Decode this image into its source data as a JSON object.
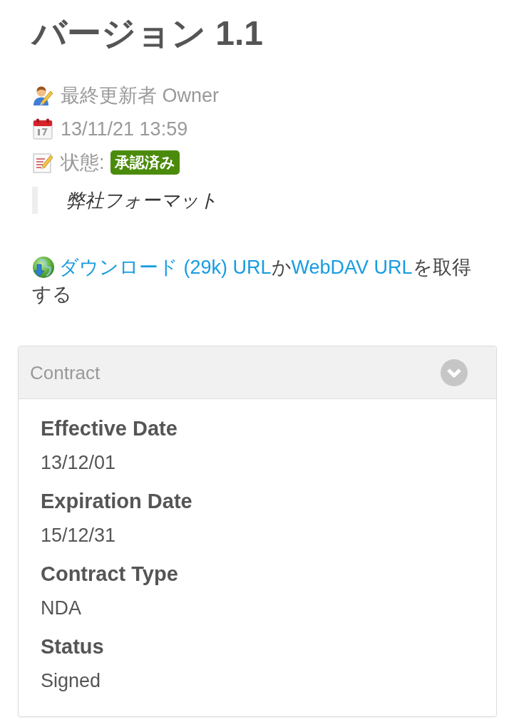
{
  "title": "バージョン 1.1",
  "meta": [
    {
      "kind": "updated_by",
      "text": "最終更新者 Owner"
    },
    {
      "kind": "date",
      "text": "13/11/21 13:59"
    },
    {
      "kind": "status",
      "text": "状態:",
      "badge": "承認済み"
    }
  ],
  "quote": "弊社フォーマット",
  "download": {
    "parts": [
      {
        "kind": "link",
        "text": "ダウンロード (29k) URL"
      },
      {
        "kind": "text",
        "text": "か"
      },
      {
        "kind": "link",
        "text": "WebDAV URL"
      },
      {
        "kind": "text",
        "text": "を取得する"
      }
    ]
  },
  "panel": {
    "title": "Contract",
    "expanded": true,
    "fields": [
      {
        "label": "Effective Date",
        "value": "13/12/01"
      },
      {
        "label": "Expiration Date",
        "value": "15/12/31"
      },
      {
        "label": "Contract Type",
        "value": "NDA"
      },
      {
        "label": "Status",
        "value": "Signed"
      }
    ]
  }
}
